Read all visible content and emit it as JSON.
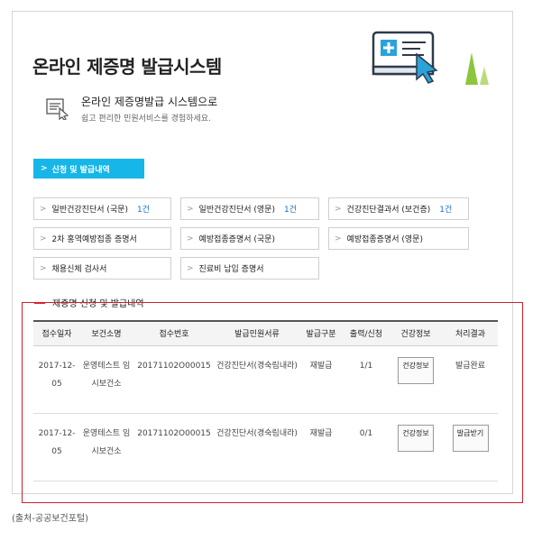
{
  "page": {
    "title": "온라인 제증명 발급시스템",
    "subtitle": "온라인 제증명발급 시스템으로",
    "description": "쉽고 편리한 민원서비스를 경험하세요."
  },
  "active_tab": "신청 및 발급내역",
  "certificates": [
    {
      "label": "일반건강진단서 (국문)",
      "count": "1건"
    },
    {
      "label": "일반건강진단서 (영문)",
      "count": "1건"
    },
    {
      "label": "건강진단결과서 (보건증)",
      "count": "1건"
    },
    {
      "label": "2차 홍역예방접종 증명서",
      "count": ""
    },
    {
      "label": "예방접종증명서 (국문)",
      "count": ""
    },
    {
      "label": "예방접종증명서 (영문)",
      "count": ""
    },
    {
      "label": "채용신체 검사서",
      "count": ""
    },
    {
      "label": "진료비 납입 증명서",
      "count": ""
    }
  ],
  "section_title": "제증명 신청 및 발급내역",
  "table": {
    "headers": [
      "접수일자",
      "보건소명",
      "접수번호",
      "발급민원서류",
      "발급구분",
      "출력/신청",
      "건강정보",
      "처리결과"
    ],
    "rows": [
      {
        "date": "2017-12-05",
        "center": "운영테스트 임시보건소",
        "receipt": "20171102O00015",
        "document": "건강진단서(경숙림내라)",
        "type": "재발급",
        "print": "1/1",
        "health_btn": "건강정보",
        "result": "발급완료",
        "result_btn": ""
      },
      {
        "date": "2017-12-05",
        "center": "운영테스트 임시보건소",
        "receipt": "20171102O00015",
        "document": "건강진단서(경숙림내라)",
        "type": "재발급",
        "print": "0/1",
        "health_btn": "건강정보",
        "result": "",
        "result_btn": "발급받기"
      }
    ]
  },
  "caption": "(출처-공공보건포털)",
  "icons": {
    "hero": "computer-cursor-illustration",
    "subtitle": "document-cursor-icon",
    "chevron": "chevron-right-icon"
  },
  "colors": {
    "accent": "#17b6e8",
    "highlight_border": "#d0202a",
    "count": "#1a6fc9",
    "tree": "#8cc63f"
  }
}
